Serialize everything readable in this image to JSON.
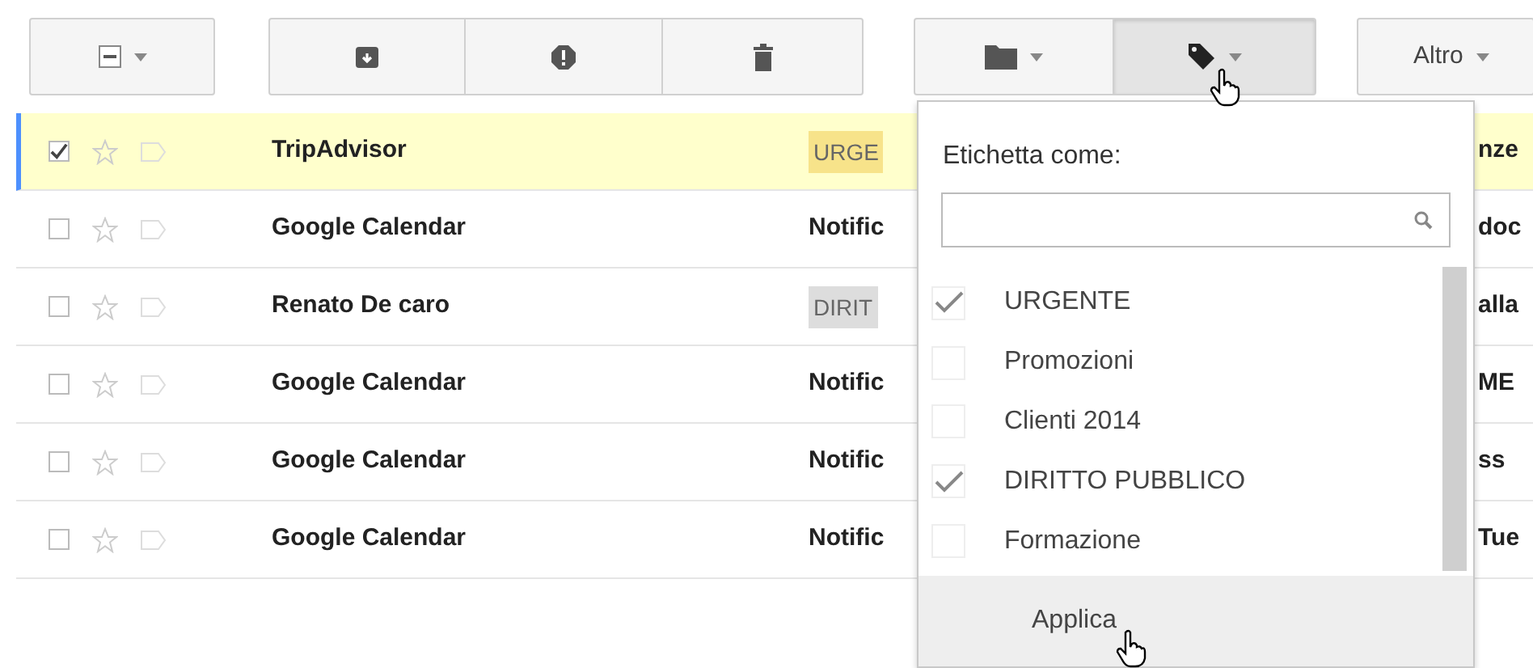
{
  "toolbar": {
    "buttons": [
      {
        "kind": "select",
        "pressed": false
      },
      {
        "kind": "archive",
        "pressed": false
      },
      {
        "kind": "spam",
        "pressed": false
      },
      {
        "kind": "delete",
        "pressed": false
      },
      {
        "kind": "move",
        "pressed": false
      },
      {
        "kind": "labels",
        "pressed": true
      },
      {
        "kind": "more",
        "label": "Altro",
        "pressed": false
      }
    ]
  },
  "rows": [
    {
      "selected": true,
      "checked": true,
      "starred": false,
      "sender": "TripAdvisor",
      "subject": {
        "kind": "tag",
        "text": "URGE",
        "color": "#f7e38a"
      },
      "trailing": "nze"
    },
    {
      "selected": false,
      "checked": false,
      "starred": false,
      "sender": "Google Calendar",
      "subject": {
        "kind": "text",
        "text": "Notific"
      },
      "trailing": "doc"
    },
    {
      "selected": false,
      "checked": false,
      "starred": false,
      "sender": "Renato De caro",
      "subject": {
        "kind": "tag",
        "text": "DIRIT",
        "color": "#dddddd"
      },
      "trailing": "alla"
    },
    {
      "selected": false,
      "checked": false,
      "starred": false,
      "sender": "Google Calendar",
      "subject": {
        "kind": "text",
        "text": "Notific"
      },
      "trailing": "ME"
    },
    {
      "selected": false,
      "checked": false,
      "starred": false,
      "sender": "Google Calendar",
      "subject": {
        "kind": "text",
        "text": "Notific"
      },
      "trailing": "ss"
    },
    {
      "selected": false,
      "checked": false,
      "starred": false,
      "sender": "Google Calendar",
      "subject": {
        "kind": "text",
        "text": "Notific"
      },
      "trailing": "Tue"
    }
  ],
  "label_menu": {
    "title": "Etichetta come:",
    "items": [
      {
        "label": "URGENTE",
        "checked": true
      },
      {
        "label": "Promozioni",
        "checked": false
      },
      {
        "label": "Clienti 2014",
        "checked": false
      },
      {
        "label": "DIRITTO PUBBLICO",
        "checked": true
      },
      {
        "label": "Formazione",
        "checked": false
      }
    ],
    "action": "Applica"
  }
}
